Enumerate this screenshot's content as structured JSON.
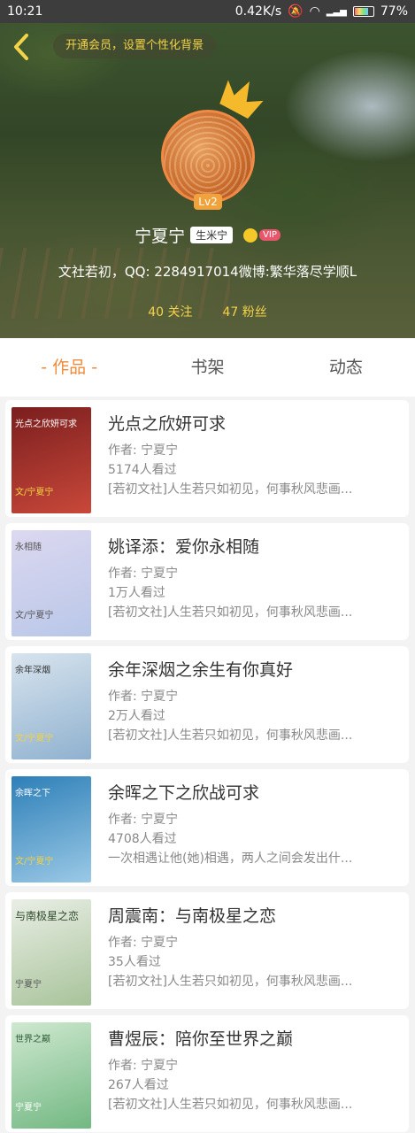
{
  "statusbar": {
    "time": "10:21",
    "speed": "0.42K/s",
    "battery": "77%"
  },
  "header": {
    "vip_tip": "开通会员，设置个性化背景",
    "level": "Lv2",
    "name": "宁夏宁",
    "tag": "生米宁",
    "vip_label": "VIP",
    "bio": "文社若初，QQ: 2284917014微博:繁华落尽学顺L",
    "follow_count": "40 关注",
    "fans_count": "47 粉丝"
  },
  "tabs": [
    {
      "label": "- 作品 -"
    },
    {
      "label": "书架"
    },
    {
      "label": "动态"
    }
  ],
  "works": [
    {
      "title": "光点之欣妍可求",
      "author": "作者: 宁夏宁",
      "views": "5174人看过",
      "desc": "[若初文社]人生若只如初见，何事秋风悲画...",
      "cover_title": "光点之欣妍可求",
      "cover_author": "文/宁夏宁",
      "colors": [
        "#7a1e1e",
        "#c9483a"
      ]
    },
    {
      "title": "姚译添：爱你永相随",
      "author": "作者: 宁夏宁",
      "views": "1万人看过",
      "desc": "[若初文社]人生若只如初见，何事秋风悲画...",
      "cover_title": "永相随",
      "cover_author": "文/宁夏宁",
      "colors": [
        "#dcd8f0",
        "#b9c7e8"
      ]
    },
    {
      "title": "余年深烟之余生有你真好",
      "author": "作者: 宁夏宁",
      "views": "2万人看过",
      "desc": "[若初文社]人生若只如初见，何事秋风悲画...",
      "cover_title": "余年深烟",
      "cover_author": "文/宁夏宁",
      "colors": [
        "#d8e4ee",
        "#8fb1cf"
      ]
    },
    {
      "title": "余晖之下之欣战可求",
      "author": "作者: 宁夏宁",
      "views": "4708人看过",
      "desc": "一次相遇让他(她)相遇，两人之间会发出什...",
      "cover_title": "余晖之下",
      "cover_author": "文/宁夏宁",
      "colors": [
        "#2d7fb8",
        "#9bc9e6"
      ]
    },
    {
      "title": "周震南：与南极星之恋",
      "author": "作者: 宁夏宁",
      "views": "35人看过",
      "desc": "[若初文社]人生若只如初见，何事秋风悲画...",
      "cover_title": "与南极星之恋",
      "cover_author": "宁夏宁",
      "colors": [
        "#e9eee5",
        "#a8c39a"
      ]
    },
    {
      "title": "曹煜辰：陪你至世界之巅",
      "author": "作者: 宁夏宁",
      "views": "267人看过",
      "desc": "[若初文社]人生若只如初见，何事秋风悲画...",
      "cover_title": "世界之巅",
      "cover_author": "宁夏宁",
      "colors": [
        "#cfe8d0",
        "#72b882"
      ]
    }
  ]
}
